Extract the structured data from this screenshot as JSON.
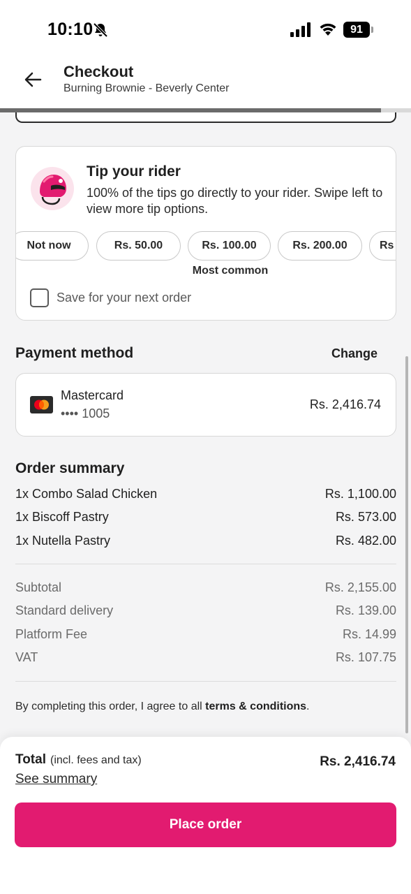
{
  "status_bar": {
    "time": "10:10",
    "battery": "91"
  },
  "header": {
    "title": "Checkout",
    "subtitle": "Burning Brownie - Beverly Center",
    "progress_percent": 92.7
  },
  "tip": {
    "title": "Tip your rider",
    "description": "100% of the tips go directly to your rider. Swipe left to view more tip options.",
    "options": [
      "Not now",
      "Rs. 50.00",
      "Rs. 100.00",
      "Rs. 200.00",
      "Rs"
    ],
    "most_common_label": "Most common",
    "save_label": "Save for your next order"
  },
  "payment": {
    "title": "Payment method",
    "change_label": "Change",
    "card_name": "Mastercard",
    "card_number": "•••• 1005",
    "amount": "Rs. 2,416.74"
  },
  "order_summary": {
    "title": "Order summary",
    "items": [
      {
        "name": "1x Combo Salad Chicken",
        "price": "Rs. 1,100.00"
      },
      {
        "name": "1x Biscoff Pastry",
        "price": "Rs. 573.00"
      },
      {
        "name": "1x Nutella Pastry",
        "price": "Rs. 482.00"
      }
    ],
    "fees": [
      {
        "name": "Subtotal",
        "price": "Rs. 2,155.00"
      },
      {
        "name": "Standard delivery",
        "price": "Rs. 139.00"
      },
      {
        "name": "Platform Fee",
        "price": "Rs. 14.99"
      },
      {
        "name": "VAT",
        "price": "Rs. 107.75"
      }
    ]
  },
  "terms": {
    "prefix": "By completing this order, I agree to all ",
    "link": "terms & conditions",
    "suffix": "."
  },
  "footer": {
    "total_label": "Total",
    "total_note": "(incl. fees and tax)",
    "see_summary": "See summary",
    "total_amount": "Rs. 2,416.74",
    "place_order": "Place order"
  },
  "colors": {
    "brand_pink": "#e21b70"
  }
}
